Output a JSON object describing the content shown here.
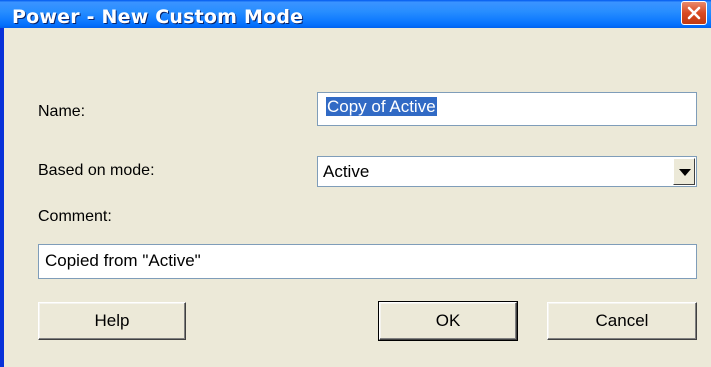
{
  "window": {
    "title": "Power - New Custom Mode",
    "close_icon": "close-icon"
  },
  "form": {
    "name_label": "Name:",
    "name_value": "Copy of Active",
    "based_on_label": "Based on mode:",
    "based_on_value": "Active",
    "comment_label": "Comment:",
    "comment_value": "Copied from \"Active\""
  },
  "buttons": {
    "help": "Help",
    "ok": "OK",
    "cancel": "Cancel"
  },
  "colors": {
    "titlebar": "#0a5ce8",
    "selection": "#316ac5",
    "dialog_bg": "#ece9d8",
    "close": "#d94a22"
  }
}
